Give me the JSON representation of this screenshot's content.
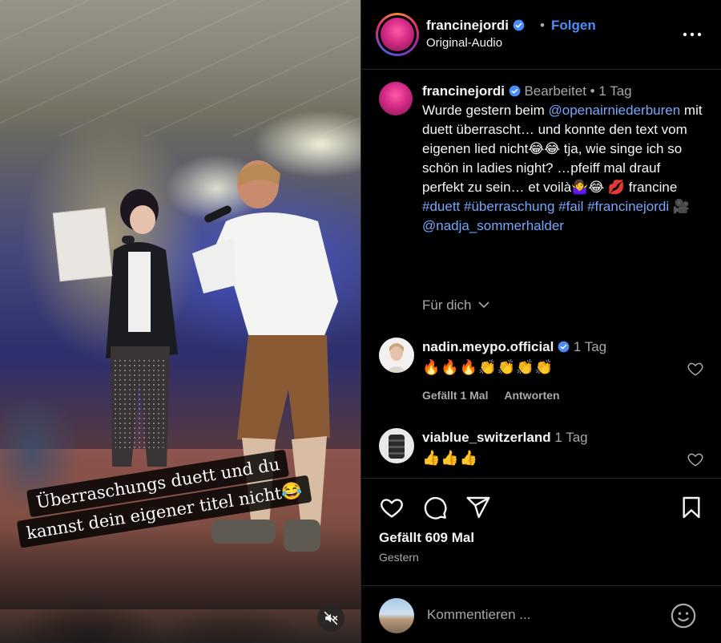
{
  "video": {
    "caption_line1": "Überraschungs duett und du",
    "caption_line2": "kannst dein eigener titel nicht😂"
  },
  "header": {
    "username": "francinejordi",
    "dot": "•",
    "follow_label": "Folgen",
    "audio": "Original-Audio"
  },
  "caption": {
    "username": "francinejordi",
    "edited": "Bearbeitet",
    "dot": "•",
    "time": "1 Tag",
    "text_1": "Wurde gestern beim ",
    "mention_1": "@openairniederburen",
    "text_2": " mit duett überrascht… und konnte den text vom eigenen lied nicht😂😂 tja, wie singe ich so schön in ladies night? …pfeiff mal drauf perfekt zu sein… et voilà🤷‍♀️😂 💋 francine ",
    "hashtag_1": "#duett",
    "hashtag_2": "#überraschung",
    "hashtag_3": "#fail",
    "hashtag_4": "#francinejordi",
    "text_3": " 🎥",
    "mention_2": "@nadja_sommerhalder"
  },
  "for_you": "Für dich",
  "comments": [
    {
      "username": "nadin.meypo.official",
      "time": "1 Tag",
      "text": "🔥🔥🔥👏👏👏👏",
      "likes": "Gefällt 1 Mal",
      "reply": "Antworten"
    },
    {
      "username": "viablue_switzerland",
      "time": "1 Tag",
      "text": "👍👍👍"
    }
  ],
  "actions": {
    "likes": "Gefällt 609 Mal",
    "date": "Gestern"
  },
  "comment_box": {
    "placeholder": "Kommentieren ..."
  },
  "icons": {
    "verified": "verified-badge-icon",
    "more": "more-options-icon",
    "like": "heart-icon",
    "comment": "comment-bubble-icon",
    "share": "paper-plane-icon",
    "save": "bookmark-icon",
    "emoji": "smiley-icon",
    "mute": "speaker-muted-icon",
    "chevron": "chevron-down-icon"
  },
  "colors": {
    "background": "#000000",
    "link": "#76a7fa",
    "follow": "#4a8df8",
    "muted_text": "#a8a8a8",
    "divider": "#262626"
  }
}
